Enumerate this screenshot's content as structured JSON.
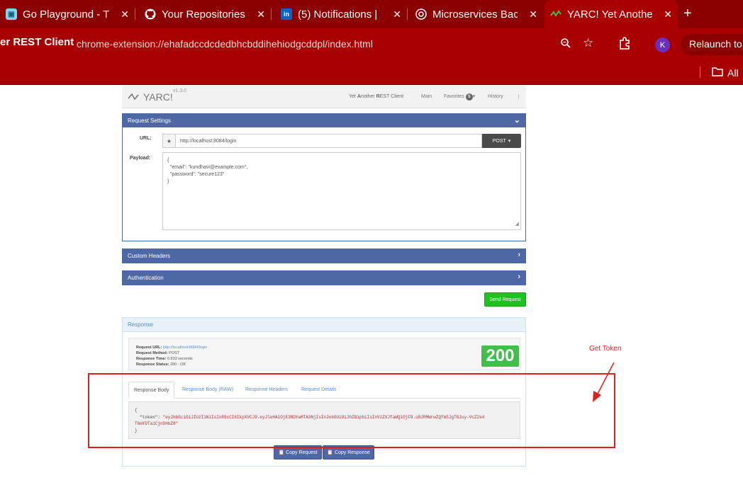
{
  "browser": {
    "tabs": [
      {
        "title": "Go Playground - T",
        "favicon": "go-gopher"
      },
      {
        "title": "Your Repositories",
        "favicon": "github"
      },
      {
        "title": "(5) Notifications |",
        "favicon": "linkedin"
      },
      {
        "title": "Microservices Bac",
        "favicon": "chatgpt"
      },
      {
        "title": "YARC! Yet Anothe",
        "favicon": "yarc"
      }
    ],
    "ext_label": "er REST Client",
    "url": "chrome-extension://ehafadccdcdedbhcbddihehiodgcddpl/index.html",
    "avatar_letter": "K",
    "relaunch_label": "Relaunch to",
    "bookmarks_folder_label": "All",
    "colors": {
      "chrome_bg": "#8b0000",
      "toolbar_bg": "#a80000"
    }
  },
  "app": {
    "logo": "YARC!",
    "version": "v1.3.0",
    "brand_sub_prefix": "Yet ",
    "brand_sub_a": "A",
    "brand_sub_mid": "nother ",
    "brand_sub_r": "R",
    "brand_sub_end": "EST Client",
    "nav": {
      "main": "Main",
      "favorites": "Favorites",
      "favorites_count": "5",
      "history": "History"
    }
  },
  "request_settings": {
    "title": "Request Settings",
    "url_label": "URL:",
    "url_value": "http://localhost:8084/login",
    "method": "POST",
    "payload_label": "Payload:",
    "payload_lines": [
      "{",
      "  \"email\": \"kundhavi@example.com\",",
      "  \"password\": \"secure123\"",
      "}"
    ]
  },
  "custom_headers": {
    "title": "Custom Headers"
  },
  "authentication": {
    "title": "Authentication"
  },
  "send_button": "Send Request",
  "response": {
    "title": "Response",
    "request_url_label": "Request URL:",
    "request_url": "http://localhost:8084/login",
    "request_method_label": "Request Method:",
    "request_method": "POST",
    "response_time_label": "Response Time:",
    "response_time": "0.833 seconds",
    "response_status_label": "Response Status:",
    "response_status": "200 - OK",
    "status_code": "200",
    "tabs": [
      "Response Body",
      "Response Body (RAW)",
      "Response Headers",
      "Request Details"
    ],
    "body_open": "{",
    "body_key": "\"token\": ",
    "body_token_line1": "\"eyJhbGciOiJIUzI1NiIsInR5cCI6IkpXVCJ9.eyJleHAiOjE3NDYwMTA3NjIsInJvbGUiOiJhZG1pbiIsInVzZXJfaWQiOjF9.o0JRMWrwZQfm5JgTGJuy-VcZ2k4",
    "body_token_line2": "T6mYDTa1CjnSHbZ8\"",
    "body_close": "}",
    "copy_request": "Copy Request",
    "copy_response": "Copy Response"
  },
  "annotation": {
    "label": "Get Token",
    "color": "#e0201c"
  }
}
